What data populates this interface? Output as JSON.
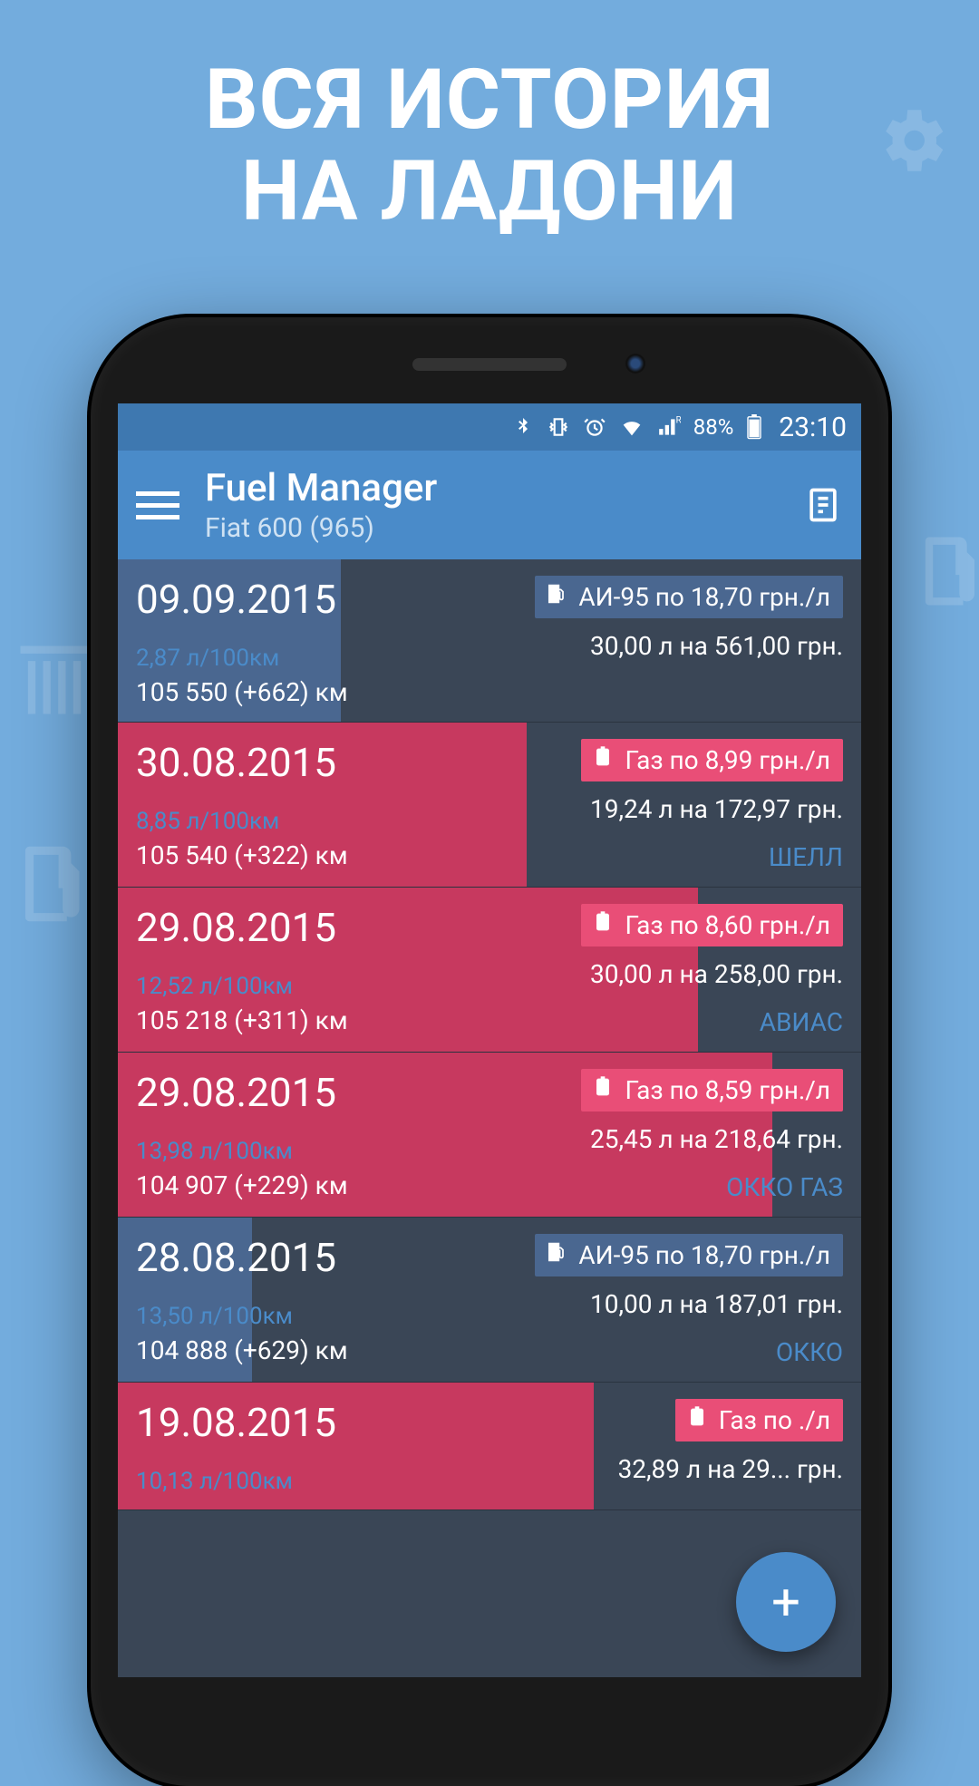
{
  "promo": {
    "headline_line1": "ВСЯ ИСТОРИЯ",
    "headline_line2": "НА ЛАДОНИ"
  },
  "status": {
    "battery_pct": "88%",
    "time": "23:10"
  },
  "appbar": {
    "title": "Fuel Manager",
    "subtitle": "Fiat 600 (965)"
  },
  "entries": [
    {
      "date": "09.09.2015",
      "consumption": "2,87 л/100км",
      "odometer": "105 550 (+662) км",
      "fuel_label": "АИ-95  по 18,70 грн./л",
      "fuel_color": "blue",
      "amounts": "30,00 л на 561,00 грн.",
      "station": "",
      "bar_pct": 30,
      "bar_color": "#4a6790"
    },
    {
      "date": "30.08.2015",
      "consumption": "8,85 л/100км",
      "odometer": "105 540 (+322) км",
      "fuel_label": "Газ  по 8,99 грн./л",
      "fuel_color": "pink",
      "amounts": "19,24 л на 172,97 грн.",
      "station": "ШЕЛЛ",
      "bar_pct": 55,
      "bar_color": "#c7395f"
    },
    {
      "date": "29.08.2015",
      "consumption": "12,52 л/100км",
      "odometer": "105 218 (+311) км",
      "fuel_label": "Газ  по 8,60 грн./л",
      "fuel_color": "pink",
      "amounts": "30,00 л на 258,00 грн.",
      "station": "АВИАС",
      "bar_pct": 78,
      "bar_color": "#c7395f"
    },
    {
      "date": "29.08.2015",
      "consumption": "13,98 л/100км",
      "odometer": "104 907 (+229) км",
      "fuel_label": "Газ  по 8,59 грн./л",
      "fuel_color": "pink",
      "amounts": "25,45 л на 218,64 грн.",
      "station": "ОККО ГАЗ",
      "bar_pct": 88,
      "bar_color": "#c7395f"
    },
    {
      "date": "28.08.2015",
      "consumption": "13,50 л/100км",
      "odometer": "104 888 (+629) км",
      "fuel_label": "АИ-95  по 18,70 грн./л",
      "fuel_color": "blue",
      "amounts": "10,00 л на 187,01 грн.",
      "station": "ОККО",
      "bar_pct": 18,
      "bar_color": "#4a6790"
    },
    {
      "date": "19.08.2015",
      "consumption": "10,13 л/100км",
      "odometer": "",
      "fuel_label": "Газ  по           ./л",
      "fuel_color": "pink",
      "amounts": "32,89 л на 29...  грн.",
      "station": "",
      "bar_pct": 64,
      "bar_color": "#c7395f"
    }
  ],
  "fab": {
    "label": "+"
  }
}
